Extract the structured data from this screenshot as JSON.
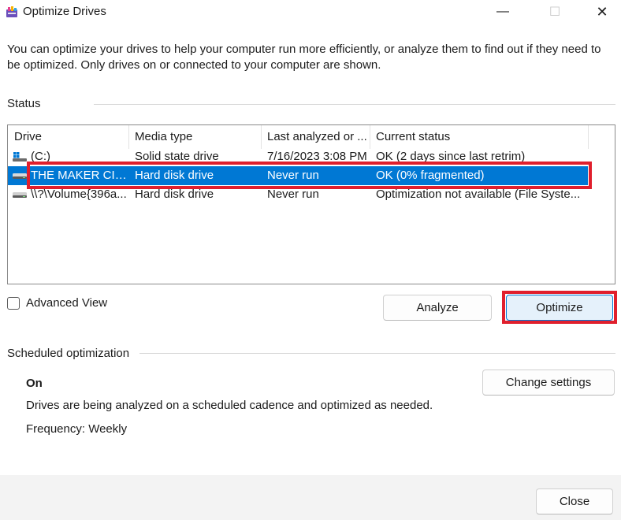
{
  "window": {
    "title": "Optimize Drives",
    "min_glyph": "—",
    "max_glyph": "☐",
    "close_glyph": "✕"
  },
  "intro_text": "You can optimize your drives to help your computer run more efficiently, or analyze them to find out if they need to be optimized. Only drives on or connected to your computer are shown.",
  "status": {
    "label": "Status",
    "columns": [
      "Drive",
      "Media type",
      "Last analyzed or ...",
      "Current status"
    ],
    "rows": [
      {
        "drive": "(C:)",
        "media_type": "Solid state drive",
        "last_analyzed": "7/16/2023 3:08 PM",
        "current_status": "OK (2 days since last retrim)",
        "icon": "windows-drive-icon",
        "selected": false
      },
      {
        "drive": "THE MAKER CITY...",
        "media_type": "Hard disk drive",
        "last_analyzed": "Never run",
        "current_status": "OK (0% fragmented)",
        "icon": "hard-disk-icon",
        "selected": true
      },
      {
        "drive": "\\\\?\\Volume{396a...",
        "media_type": "Hard disk drive",
        "last_analyzed": "Never run",
        "current_status": "Optimization not available (File Syste...",
        "icon": "hard-disk-icon",
        "selected": false
      }
    ]
  },
  "advanced_view": {
    "label": "Advanced View",
    "checked": false
  },
  "buttons": {
    "analyze": "Analyze",
    "optimize": "Optimize",
    "change_settings": "Change settings",
    "close": "Close"
  },
  "scheduled": {
    "label": "Scheduled optimization",
    "state": "On",
    "description": "Drives are being analyzed on a scheduled cadence and optimized as needed.",
    "frequency": "Frequency: Weekly"
  },
  "colors": {
    "selection": "#0078d4",
    "highlight_annotation": "#e01f2d"
  }
}
